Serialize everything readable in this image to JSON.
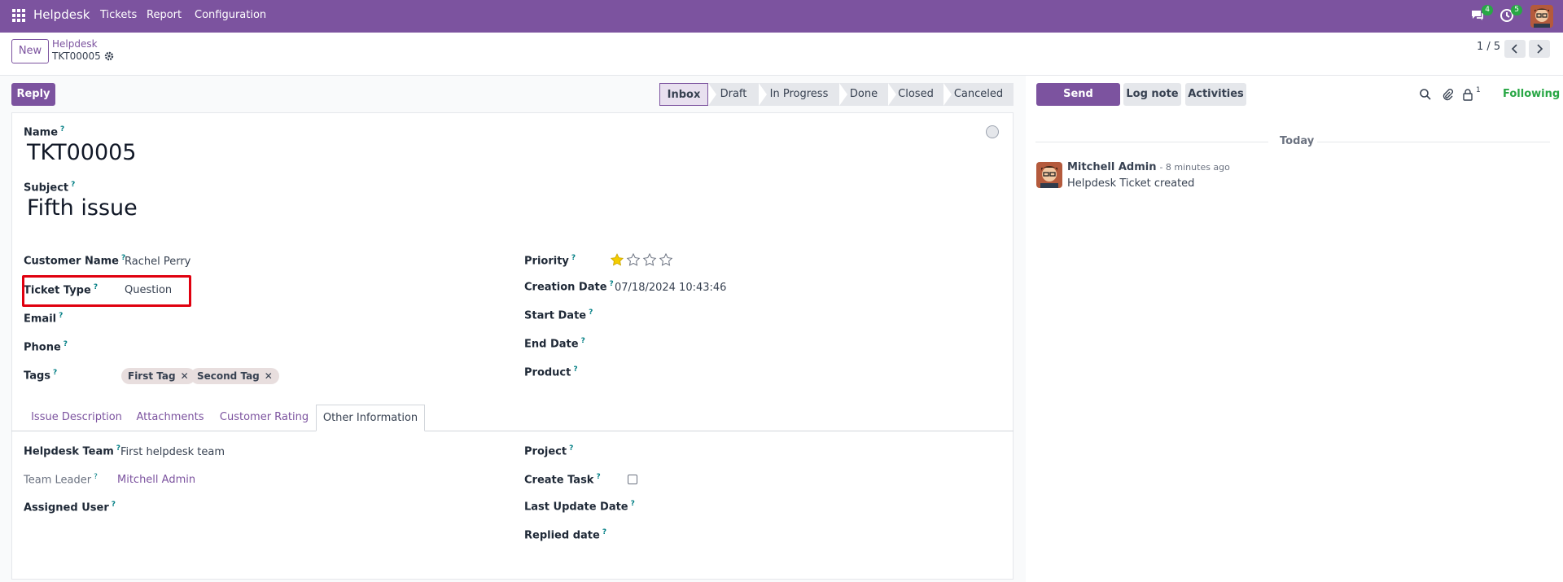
{
  "navbar": {
    "app_name": "Helpdesk",
    "menu": [
      "Tickets",
      "Report",
      "Configuration"
    ],
    "messages_badge": "4",
    "activities_badge": "5"
  },
  "control_panel": {
    "new_label": "New",
    "breadcrumb_parent": "Helpdesk",
    "breadcrumb_current": "TKT00005",
    "pager": "1 / 5"
  },
  "actions": {
    "reply_label": "Reply"
  },
  "statusbar": {
    "stages": [
      "Inbox",
      "Draft",
      "In Progress",
      "Done",
      "Closed",
      "Canceled"
    ],
    "active": "Inbox"
  },
  "chatter": {
    "send_message": "Send message",
    "log_note": "Log note",
    "activities": "Activities",
    "followers_count": "1",
    "following_label": "Following",
    "date_separator": "Today",
    "message": {
      "author": "Mitchell Admin",
      "time": "- 8 minutes ago",
      "body": "Helpdesk Ticket created"
    }
  },
  "form": {
    "name_label": "Name",
    "name_value": "TKT00005",
    "subject_label": "Subject",
    "subject_value": "Fifth issue",
    "left_fields": {
      "customer_name_label": "Customer Name",
      "customer_name_value": "Rachel Perry",
      "ticket_type_label": "Ticket Type",
      "ticket_type_value": "Question",
      "email_label": "Email",
      "phone_label": "Phone",
      "tags_label": "Tags",
      "tags": [
        "First Tag",
        "Second Tag"
      ]
    },
    "right_fields": {
      "priority_label": "Priority",
      "priority_stars_filled": 1,
      "priority_stars_total": 4,
      "creation_date_label": "Creation Date",
      "creation_date_value": "07/18/2024 10:43:46",
      "start_date_label": "Start Date",
      "end_date_label": "End Date",
      "product_label": "Product"
    },
    "tabs": [
      "Issue Description",
      "Attachments",
      "Customer Rating",
      "Other Information"
    ],
    "active_tab": "Other Information",
    "other_info": {
      "helpdesk_team_label": "Helpdesk Team",
      "helpdesk_team_value": "First helpdesk team",
      "team_leader_label": "Team Leader",
      "team_leader_value": "Mitchell Admin",
      "assigned_user_label": "Assigned User",
      "project_label": "Project",
      "create_task_label": "Create Task",
      "last_update_label": "Last Update Date",
      "replied_date_label": "Replied date"
    },
    "help_mark": "?"
  },
  "colors": {
    "brand": "#7c539f",
    "following": "#28a745",
    "highlight": "#e0000f",
    "star": "#f3cc00"
  }
}
